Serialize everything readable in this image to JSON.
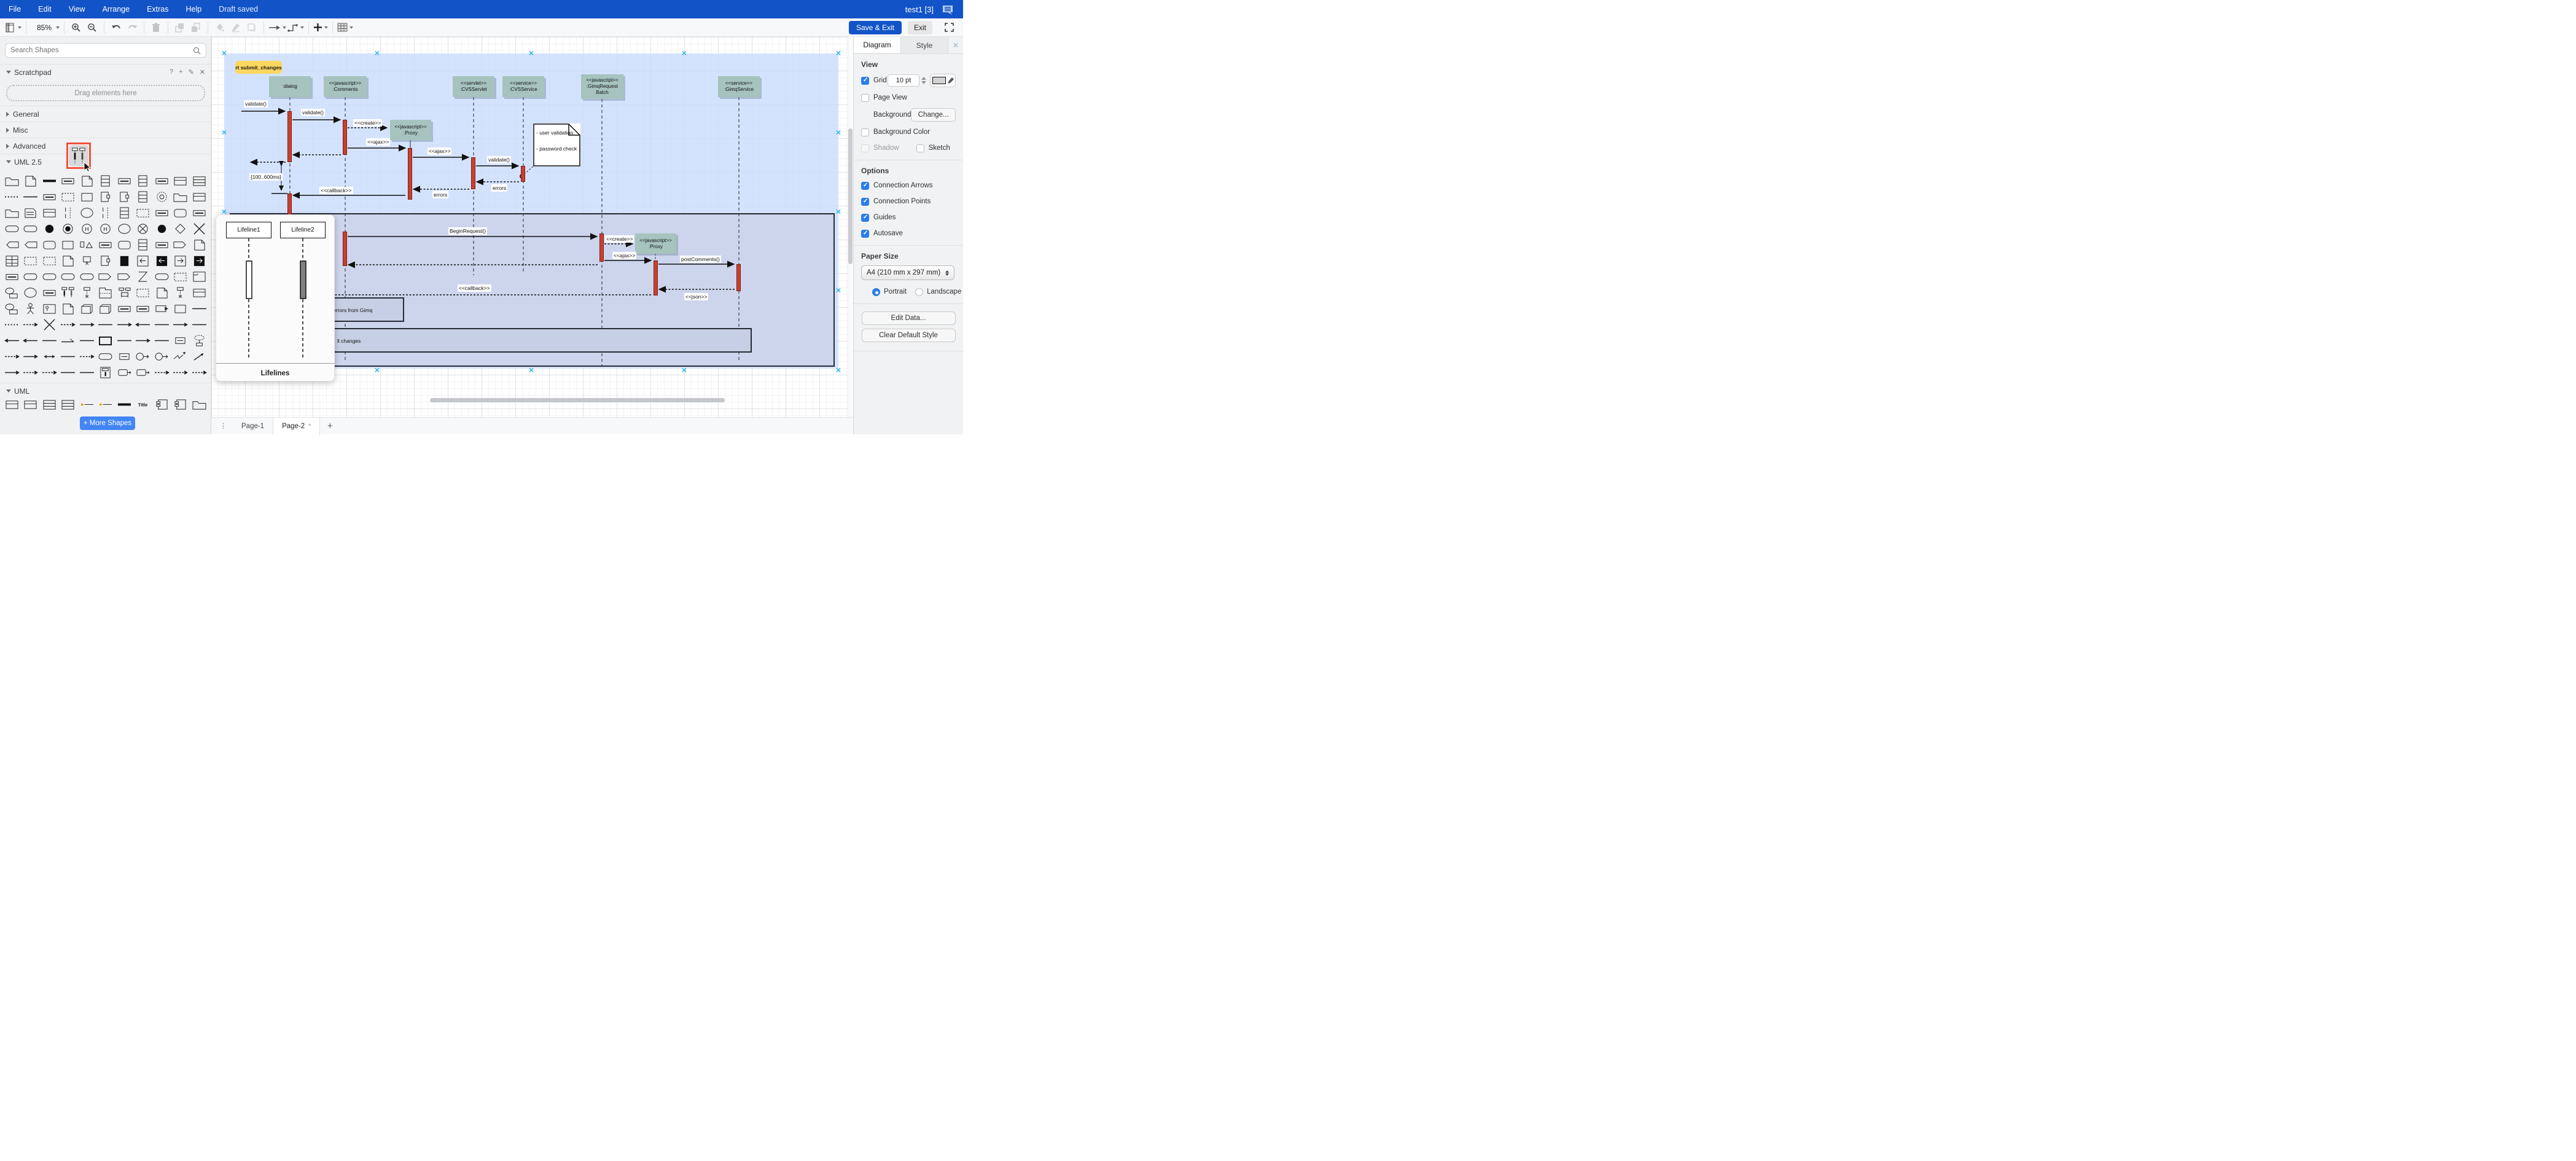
{
  "menubar": {
    "items": [
      "File",
      "Edit",
      "View",
      "Arrange",
      "Extras",
      "Help"
    ],
    "status": "Draft saved",
    "doc_title": "test1 [3]"
  },
  "toolbar": {
    "zoom_level": "85%",
    "save_exit_label": "Save & Exit",
    "exit_label": "Exit"
  },
  "sidebar": {
    "search_placeholder": "Search Shapes",
    "scratchpad": {
      "title": "Scratchpad",
      "drop_hint": "Drag elements here"
    },
    "sections": [
      {
        "label": "General"
      },
      {
        "label": "Misc"
      },
      {
        "label": "Advanced"
      },
      {
        "label": "UML 2.5"
      },
      {
        "label": "UML"
      }
    ],
    "more_shapes_label": "+ More Shapes",
    "palette": {
      "rows": [
        [
          "folder",
          "note",
          "thick",
          "label",
          "note",
          "list3",
          "label",
          "list3",
          "label",
          "class",
          "enum"
        ],
        [
          "dots",
          "line",
          "label",
          "dashrect",
          "rect",
          "port",
          "port",
          "list3",
          "ring",
          "folder",
          "class"
        ],
        [
          "folder",
          "stereo",
          "class",
          "region",
          "ellipse",
          "region",
          "list3",
          "dashrect",
          "label",
          "state",
          "label"
        ],
        [
          "pill",
          "pill",
          "dot",
          "ringdot",
          "circH",
          "circH",
          "ellipse",
          "circX",
          "dot",
          "diamond",
          "cross"
        ],
        [
          "chevL",
          "chevL",
          "state",
          "rect",
          "tri",
          "label",
          "state",
          "list3",
          "label",
          "chevR",
          "note"
        ],
        [
          "table",
          "dashrect",
          "dashrect",
          "note",
          "pin",
          "port",
          "black",
          "arrWL",
          "arrBL",
          "arrWR",
          "arrBR"
        ],
        [
          "label",
          "pill",
          "pill",
          "pill",
          "pill",
          "chevR",
          "chevR",
          "x2",
          "pill",
          "dashrect",
          "frame"
        ],
        [
          "ext",
          "ellipse",
          "label",
          "lifepair",
          "lifeline",
          "bigfold",
          "twin",
          "dashrect",
          "note",
          "lifeline",
          "class"
        ],
        [
          "ext",
          "stickman",
          "actorbox",
          "note",
          "deploy",
          "deploy",
          "label",
          "label",
          "info",
          "rect",
          "line"
        ],
        [
          "dots",
          "darrR",
          "cross",
          "darrR",
          "arrR",
          "line",
          "arrR",
          "arrL",
          "line",
          "arrR",
          "line"
        ],
        [
          "arrL",
          "arrL",
          "line",
          "halfarr",
          "line",
          "qualifier",
          "line",
          "arrR",
          "line",
          "objnode",
          "collab"
        ],
        [
          "darrR",
          "arrR",
          "dbl",
          "line",
          "darrR",
          "pill",
          "objnode",
          "ringarr",
          "ringarr",
          "zigzag",
          "diag"
        ],
        [
          "arrR",
          "darrR",
          "darrR",
          "line",
          "line",
          "llbox",
          "msg",
          "msg",
          "darrR",
          "darrR",
          "darrR"
        ]
      ],
      "uml_row": [
        "class",
        "class",
        "enum",
        "enum",
        "attr",
        "attr",
        "thick",
        "title",
        "comp",
        "comp",
        "folder"
      ]
    }
  },
  "popup": {
    "lifeline1": "Lifeline1",
    "lifeline2": "Lifeline2",
    "title": "Lifelines"
  },
  "canvas": {
    "frame_label": "rt submit_changes",
    "lifelines": [
      {
        "st": "",
        "nm": ":dialog"
      },
      {
        "st": "<<javascript>>",
        "nm": ":Comments"
      },
      {
        "st": "<<servlet>>",
        "nm": ":CVSServlet"
      },
      {
        "st": "<<service>>",
        "nm": ":CVSService"
      },
      {
        "st": "<<javascript>>",
        "nm": ":GimqRequest Batch"
      },
      {
        "st": "<<service>>",
        "nm": ":GimqService"
      }
    ],
    "proxy1": {
      "st": "<<javascript>>",
      "nm": ":Proxy"
    },
    "proxy2": {
      "st": "<<javascript>>",
      "nm": ":Proxy"
    },
    "messages": {
      "validate1": "validate()",
      "validate2": "validate()",
      "validate3": "validate()",
      "create1": "<<create>>",
      "create2": "<<create>>",
      "ajax1": "<<ajax>>",
      "ajax2": "<<ajax>>",
      "ajax3": "<<ajax>>",
      "callback1": "<<callback>>",
      "callback2": "<<callback>>",
      "json": "<<json>>",
      "begin_request": "BeginRequest()",
      "post_comments": "postComments()",
      "errors1": "errors",
      "errors2": "errors",
      "timing": "{100..600ms}"
    },
    "note_lines": [
      "- user validation",
      "- password check"
    ],
    "errors_box": "errors from Gimq",
    "changes_bar": "ll changes"
  },
  "footer": {
    "pages": [
      "Page-1",
      "Page-2"
    ],
    "active_chevron": "^"
  },
  "panel": {
    "tabs": [
      "Diagram",
      "Style"
    ],
    "view": {
      "title": "View",
      "grid_label": "Grid",
      "grid_size": "10 pt",
      "page_view": "Page View",
      "background_label": "Background",
      "change_button": "Change...",
      "background_color": "Background Color",
      "shadow": "Shadow",
      "sketch": "Sketch"
    },
    "options": {
      "title": "Options",
      "items": [
        "Connection Arrows",
        "Connection Points",
        "Guides",
        "Autosave"
      ]
    },
    "paper": {
      "title": "Paper Size",
      "value": "A4 (210 mm x 297 mm)",
      "portrait": "Portrait",
      "landscape": "Landscape"
    },
    "buttons": [
      "Edit Data...",
      "Clear Default Style"
    ]
  }
}
